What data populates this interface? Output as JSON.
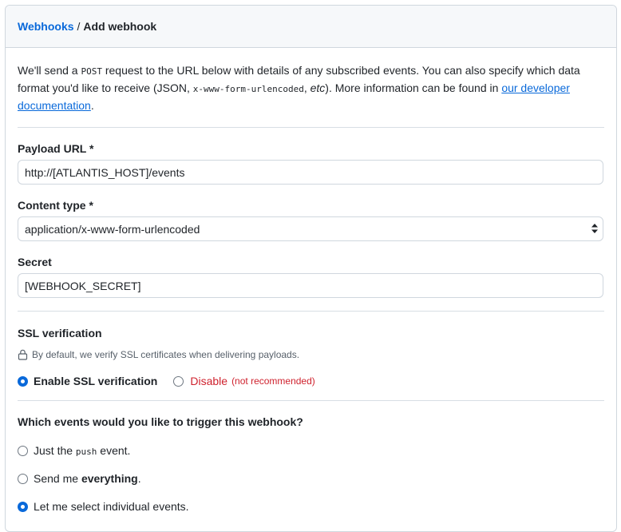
{
  "breadcrumb": {
    "parent": "Webhooks",
    "separator": "/",
    "current": "Add webhook"
  },
  "intro": {
    "part1": "We'll send a ",
    "method": "POST",
    "part2": " request to the URL below with details of any subscribed events. You can also specify which data format you'd like to receive (JSON, ",
    "format_code": "x-www-form-urlencoded",
    "part3": ", ",
    "etc": "etc",
    "part4": "). More information can be found in ",
    "link": "our developer documentation",
    "part5": "."
  },
  "payload_url": {
    "label": "Payload URL *",
    "value": "http://[ATLANTIS_HOST]/events"
  },
  "content_type": {
    "label": "Content type *",
    "selected": "application/x-www-form-urlencoded"
  },
  "secret": {
    "label": "Secret",
    "value": "[WEBHOOK_SECRET]"
  },
  "ssl": {
    "title": "SSL verification",
    "note": "By default, we verify SSL certificates when delivering payloads.",
    "enable_label": "Enable SSL verification",
    "disable_label": "Disable",
    "disable_note": "(not recommended)"
  },
  "events": {
    "title": "Which events would you like to trigger this webhook?",
    "option1_pre": "Just the ",
    "option1_code": "push",
    "option1_post": " event.",
    "option2_pre": "Send me ",
    "option2_bold": "everything",
    "option2_post": ".",
    "option3": "Let me select individual events.",
    "selected": 3
  },
  "colors": {
    "accent": "#0969da",
    "danger": "#cf222e",
    "border": "#d0d7de",
    "header_bg": "#f6f8fa"
  }
}
